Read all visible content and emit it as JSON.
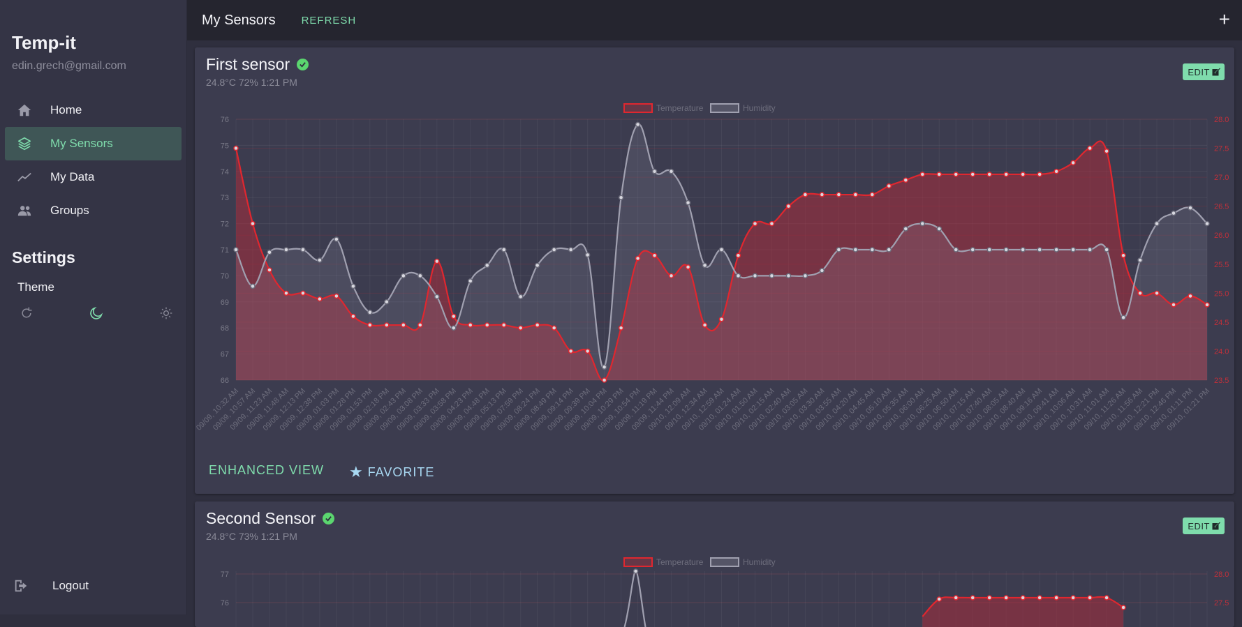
{
  "app": {
    "name": "Temp-it",
    "email": "edin.grech@gmail.com"
  },
  "sidebar": {
    "items": [
      {
        "label": "Home",
        "icon": "home-icon"
      },
      {
        "label": "My Sensors",
        "icon": "layers-icon",
        "active": true
      },
      {
        "label": "My Data",
        "icon": "trend-icon"
      },
      {
        "label": "Groups",
        "icon": "people-icon"
      }
    ],
    "settings_heading": "Settings",
    "theme_label": "Theme",
    "theme_options": [
      "auto",
      "dark",
      "light"
    ],
    "theme_selected": "dark",
    "logout_label": "Logout"
  },
  "header": {
    "title": "My Sensors",
    "refresh_label": "REFRESH",
    "add_label": "+"
  },
  "colors": {
    "accent": "#7fdcac",
    "temperature": "#e0272f",
    "humidity": "#a0a0b0",
    "favorite": "#a8d8f2"
  },
  "sensors": [
    {
      "name": "First sensor",
      "status": "online",
      "summary": "24.8°C 72% 1:21 PM",
      "edit_label": "EDIT",
      "enhanced_label": "ENHANCED VIEW",
      "favorite_label": "FAVORITE"
    },
    {
      "name": "Second Sensor",
      "status": "online",
      "summary": "24.8°C 73% 1:21 PM",
      "edit_label": "EDIT"
    }
  ],
  "chart_data": [
    {
      "type": "line",
      "legend": [
        "Temperature",
        "Humidity"
      ],
      "legend_position": "top-center",
      "y_left": {
        "ticks": [
          66,
          67,
          68,
          69,
          70,
          71,
          72,
          73,
          74,
          75,
          76
        ],
        "range": [
          66,
          76
        ]
      },
      "y_right": {
        "ticks": [
          "23.5",
          "24.0",
          "24.5",
          "25.0",
          "25.5",
          "26.0",
          "26.5",
          "27.0",
          "27.5",
          "28.0"
        ],
        "range": [
          23.5,
          28.0
        ]
      },
      "x": [
        "09/09, 10:32 AM",
        "09/09, 10:57 AM",
        "09/09, 11:23 AM",
        "09/09, 11:48 AM",
        "09/09, 12:13 PM",
        "09/09, 12:38 PM",
        "09/09, 01:03 PM",
        "09/09, 01:28 PM",
        "09/09, 01:53 PM",
        "09/09, 02:18 PM",
        "09/09, 02:43 PM",
        "09/09, 03:08 PM",
        "09/09, 03:33 PM",
        "09/09, 03:58 PM",
        "09/09, 04:23 PM",
        "09/09, 04:48 PM",
        "09/09, 05:13 PM",
        "09/09, 07:59 PM",
        "09/09, 08:24 PM",
        "09/09, 08:49 PM",
        "09/09, 09:14 PM",
        "09/09, 09:39 PM",
        "09/09, 10:04 PM",
        "09/09, 10:29 PM",
        "09/09, 10:54 PM",
        "09/09, 11:19 PM",
        "09/09, 11:44 PM",
        "09/10, 12:09 AM",
        "09/10, 12:34 AM",
        "09/10, 12:59 AM",
        "09/10, 01:24 AM",
        "09/10, 01:50 AM",
        "09/10, 02:15 AM",
        "09/10, 02:40 AM",
        "09/10, 03:05 AM",
        "09/10, 03:30 AM",
        "09/10, 03:55 AM",
        "09/10, 04:20 AM",
        "09/10, 04:45 AM",
        "09/10, 05:10 AM",
        "09/10, 05:35 AM",
        "09/10, 06:00 AM",
        "09/10, 06:25 AM",
        "09/10, 06:50 AM",
        "09/10, 07:15 AM",
        "09/10, 07:40 AM",
        "09/10, 08:05 AM",
        "09/10, 08:40 AM",
        "09/10, 09:16 AM",
        "09/10, 09:41 AM",
        "09/10, 10:06 AM",
        "09/10, 10:31 AM",
        "09/10, 11:01 AM",
        "09/10, 11:26 AM",
        "09/10, 11:56 AM",
        "09/10, 12:21 PM",
        "09/10, 12:46 PM",
        "09/10, 01:11 PM",
        "09/10, 01:21 PM"
      ],
      "series": [
        {
          "name": "Temperature",
          "axis": "right",
          "values": [
            27.5,
            26.2,
            25.4,
            25.0,
            25.0,
            24.9,
            24.95,
            24.6,
            24.45,
            24.45,
            24.45,
            24.45,
            25.55,
            24.6,
            24.45,
            24.45,
            24.45,
            24.4,
            24.45,
            24.4,
            24.0,
            24.0,
            23.5,
            24.4,
            25.6,
            25.65,
            25.3,
            25.45,
            24.45,
            24.55,
            25.65,
            26.2,
            26.2,
            26.5,
            26.7,
            26.7,
            26.7,
            26.7,
            26.7,
            26.85,
            26.95,
            27.05,
            27.05,
            27.05,
            27.05,
            27.05,
            27.05,
            27.05,
            27.05,
            27.1,
            27.25,
            27.5,
            27.45,
            25.65,
            25.0,
            25.0,
            24.8,
            24.95,
            24.8
          ]
        },
        {
          "name": "Humidity",
          "axis": "left",
          "values": [
            71.0,
            69.6,
            70.9,
            71.0,
            71.0,
            70.6,
            71.4,
            69.6,
            68.6,
            69.0,
            70.0,
            70.0,
            69.2,
            68.0,
            69.8,
            70.4,
            71.0,
            69.2,
            70.4,
            71.0,
            71.0,
            70.8,
            66.5,
            73.0,
            75.8,
            74.0,
            74.0,
            72.8,
            70.4,
            71.0,
            70.0,
            70.0,
            70.0,
            70.0,
            70.0,
            70.2,
            71.0,
            71.0,
            71.0,
            71.0,
            71.8,
            72.0,
            71.8,
            71.0,
            71.0,
            71.0,
            71.0,
            71.0,
            71.0,
            71.0,
            71.0,
            71.0,
            71.0,
            68.4,
            70.6,
            72.0,
            72.4,
            72.6,
            72.0
          ]
        }
      ]
    },
    {
      "type": "line",
      "legend": [
        "Temperature",
        "Humidity"
      ],
      "legend_position": "top-center",
      "y_left": {
        "ticks": [
          76,
          77
        ],
        "range": [
          75,
          77
        ]
      },
      "y_right": {
        "ticks": [
          "27.5",
          "28.0"
        ],
        "range": [
          27.0,
          28.0
        ]
      },
      "partial": true
    }
  ]
}
